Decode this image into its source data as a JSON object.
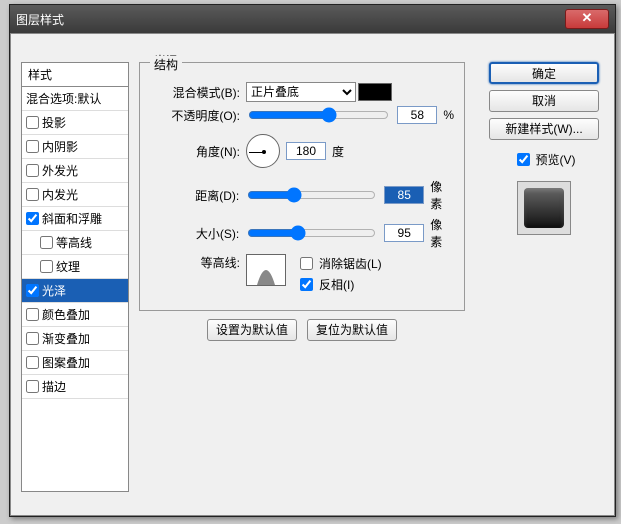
{
  "window": {
    "title": "图层样式"
  },
  "stylePanel": {
    "header": "样式",
    "blend": "混合选项:默认",
    "items": [
      {
        "label": "投影",
        "checked": false,
        "indent": false
      },
      {
        "label": "内阴影",
        "checked": false,
        "indent": false
      },
      {
        "label": "外发光",
        "checked": false,
        "indent": false
      },
      {
        "label": "内发光",
        "checked": false,
        "indent": false
      },
      {
        "label": "斜面和浮雕",
        "checked": true,
        "indent": false
      },
      {
        "label": "等高线",
        "checked": false,
        "indent": true
      },
      {
        "label": "纹理",
        "checked": false,
        "indent": true
      },
      {
        "label": "光泽",
        "checked": true,
        "indent": false,
        "selected": true
      },
      {
        "label": "颜色叠加",
        "checked": false,
        "indent": false
      },
      {
        "label": "渐变叠加",
        "checked": false,
        "indent": false
      },
      {
        "label": "图案叠加",
        "checked": false,
        "indent": false
      },
      {
        "label": "描边",
        "checked": false,
        "indent": false
      }
    ]
  },
  "main": {
    "sectionTitle": "光泽",
    "groupTitle": "结构",
    "blendMode": {
      "label": "混合模式(B):",
      "value": "正片叠底"
    },
    "opacity": {
      "label": "不透明度(O):",
      "value": "58",
      "unit": "%"
    },
    "angle": {
      "label": "角度(N):",
      "value": "180",
      "unit": "度"
    },
    "distance": {
      "label": "距离(D):",
      "value": "85",
      "unit": "像素"
    },
    "size": {
      "label": "大小(S):",
      "value": "95",
      "unit": "像素"
    },
    "contour": {
      "label": "等高线:"
    },
    "antiAlias": {
      "label": "消除锯齿(L)",
      "checked": false
    },
    "invert": {
      "label": "反相(I)",
      "checked": true
    },
    "resetBtn": "设置为默认值",
    "restoreBtn": "复位为默认值"
  },
  "right": {
    "ok": "确定",
    "cancel": "取消",
    "newStyle": "新建样式(W)...",
    "preview": "预览(V)",
    "previewChecked": true
  }
}
